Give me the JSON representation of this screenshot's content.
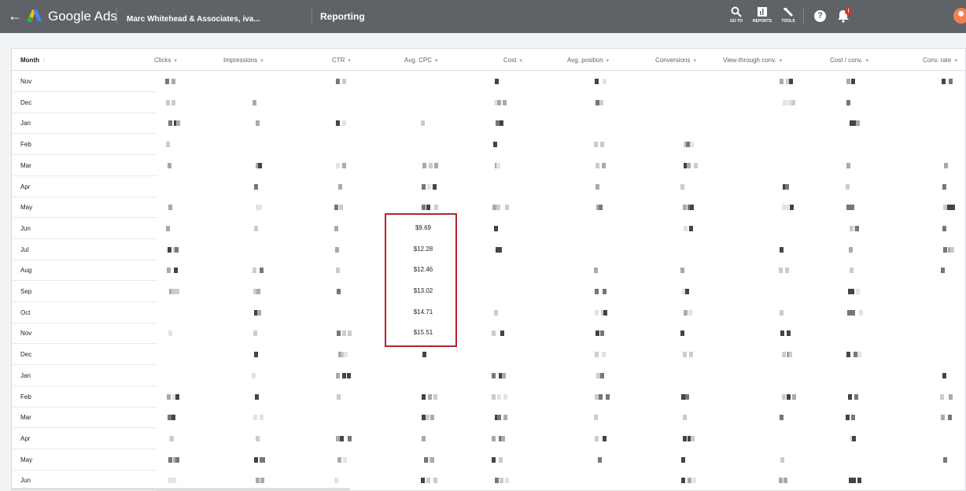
{
  "header": {
    "app_name": "Google Ads",
    "account_name": "Marc Whitehead & Associates, iva...",
    "section": "Reporting",
    "tools": [
      {
        "label": "GO TO",
        "icon": "search-icon"
      },
      {
        "label": "REPORTS",
        "icon": "reports-icon"
      },
      {
        "label": "TOOLS",
        "icon": "wrench-icon"
      }
    ],
    "notification_badge": "!"
  },
  "table": {
    "columns": [
      "Month",
      "Clicks",
      "Impressions",
      "CTR",
      "Avg. CPC",
      "Cost",
      "Avg. position",
      "Conversions",
      "View-through conv.",
      "Cost / conv.",
      "Conv. rate"
    ],
    "months": [
      "Nov",
      "Dec",
      "Jan",
      "Feb",
      "Mar",
      "Apr",
      "May",
      "Jun",
      "Jul",
      "Aug",
      "Sep",
      "Oct",
      "Nov",
      "Dec",
      "Jan",
      "Feb",
      "Mar",
      "Apr",
      "May",
      "Jun"
    ],
    "highlighted_cpc": [
      "$9.69",
      "$12.28",
      "$12.46",
      "$13.02",
      "$14.71",
      "$15.51"
    ]
  },
  "colors": {
    "header_bg": "#5f6368",
    "highlight_border": "#b3262d",
    "accent_orange": "#f57e4a"
  }
}
